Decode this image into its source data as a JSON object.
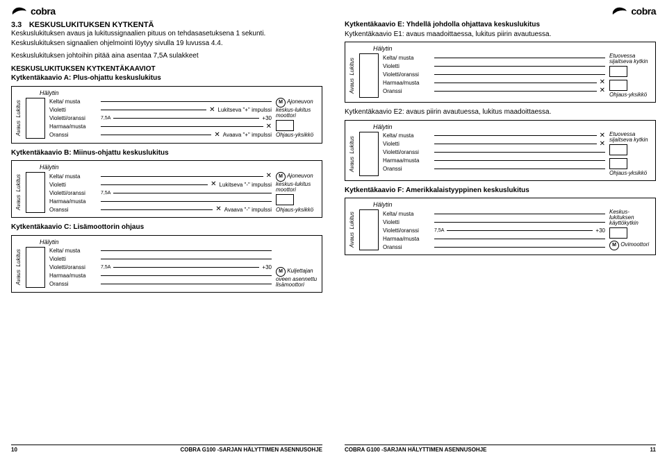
{
  "brand": "cobra",
  "left": {
    "section_num": "3.3",
    "section_title": "KESKUSLUKITUKSEN KYTKENTÄ",
    "p1": "Keskuslukituksen avaus ja lukitussignaalien pituus on tehdasasetuksena 1 sekunti.",
    "p2": "Keskuslukituksen signaalien ohjelmointi löytyy sivulla 19 luvussa 4.4.",
    "p3": "Keskuslukituksen johtoihin pitää aina asentaa 7,5A sulakkeet",
    "h1": "KESKUSLUKITUKSEN KYTKENTÄKAAVIOT",
    "h2": "Kytkentäkaavio A: Plus-ohjattu keskuslukitus",
    "halytin": "Hälytin",
    "sideA": "Avaus",
    "sideB": "Lukitus",
    "wires": {
      "w1": "Kelta/ musta",
      "w2": "Violetti",
      "w3": "Violetti/oranssi",
      "w4": "Harmaa/musta",
      "w5": "Oranssi"
    },
    "fuse": "7,5A",
    "plus30": "+30",
    "impA_lock": "Lukitseva \"+\" impulssi",
    "impA_open": "Avaava \"+\" impulssi",
    "rA1": "Ajoneuvon keskus-lukitus moottori",
    "rA2": "Ohjaus-yksikkö",
    "M": "M",
    "titleB": "Kytkentäkaavio B: Miinus-ohjattu keskuslukitus",
    "impB_lock": "Lukitseva \"-\" impulssi",
    "impB_open": "Avaava \"-\" impulssi",
    "titleC": "Kytkentäkaavio C: Lisämoottorin ohjaus",
    "rC": "Kuljettajan oveen asennettu lisämoottori",
    "footer_text": "COBRA G100 -SARJAN HÄLYTTIMEN ASENNUSOHJE",
    "page_num": "10"
  },
  "right": {
    "titleE": "Kytkentäkaavio E: Yhdellä johdolla ohjattava keskuslukitus",
    "titleE1": "Kytkentäkaavio E1: avaus maadoittaessa, lukitus piirin avautuessa.",
    "rE1": "Etuovessa sijaitseva kytkin",
    "rE2": "Ohjaus-yksikkö",
    "titleE2": "Kytkentäkaavio E2: avaus piirin avautuessa, lukitus maadoittaessa.",
    "titleF": "Kytkentäkaavio F: Amerikkalaistyyppinen keskuslukitus",
    "rF1": "Keskus-lukituksen käyttökytkin",
    "rF2": "Ovimoottori",
    "page_num": "11"
  }
}
